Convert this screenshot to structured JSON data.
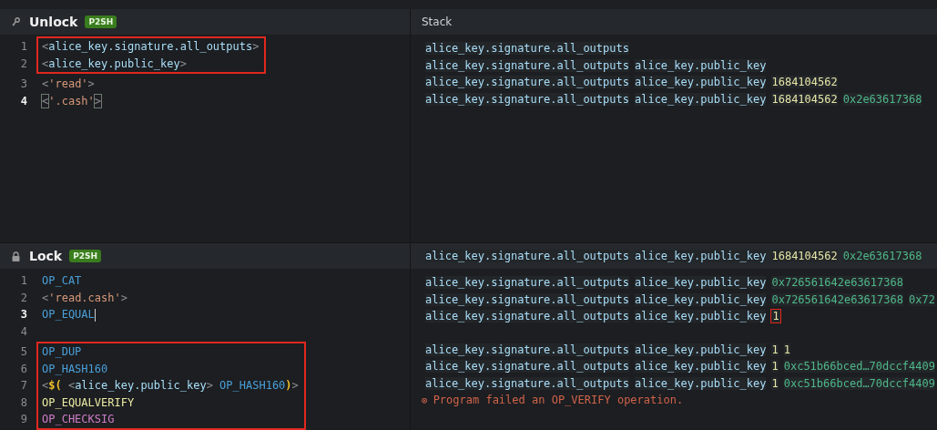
{
  "unlock": {
    "title": "Unlock",
    "badge": "P2SH",
    "groups": [
      {
        "highlighted": true,
        "lines": [
          {
            "number": "1",
            "active": false,
            "tokens": [
              {
                "kind": "punct",
                "text": "<"
              },
              {
                "kind": "name",
                "text": "alice_key.signature.all_outputs"
              },
              {
                "kind": "punct",
                "text": ">"
              }
            ]
          },
          {
            "number": "2",
            "active": false,
            "tokens": [
              {
                "kind": "punct",
                "text": "<"
              },
              {
                "kind": "name",
                "text": "alice_key.public_key"
              },
              {
                "kind": "punct",
                "text": ">"
              }
            ]
          }
        ]
      },
      {
        "highlighted": false,
        "lines": [
          {
            "number": "3",
            "active": false,
            "tokens": [
              {
                "kind": "punct",
                "text": "<"
              },
              {
                "kind": "string",
                "text": "'read'"
              },
              {
                "kind": "punct",
                "text": ">"
              }
            ]
          },
          {
            "number": "4",
            "active": true,
            "tokens": [
              {
                "kind": "match",
                "text": "<"
              },
              {
                "kind": "string",
                "text": "'.cash'"
              },
              {
                "kind": "match",
                "text": ">"
              }
            ]
          }
        ]
      }
    ]
  },
  "lock": {
    "title": "Lock",
    "badge": "P2SH",
    "groups": [
      {
        "highlighted": false,
        "lines": [
          {
            "number": "1",
            "active": false,
            "tokens": [
              {
                "kind": "opcode",
                "text": "OP_CAT"
              }
            ]
          },
          {
            "number": "2",
            "active": false,
            "tokens": [
              {
                "kind": "punct",
                "text": "<"
              },
              {
                "kind": "string",
                "text": "'read.cash'"
              },
              {
                "kind": "punct",
                "text": ">"
              }
            ]
          },
          {
            "number": "3",
            "active": true,
            "tokens": [
              {
                "kind": "opcode",
                "text": "OP_EQUAL"
              }
            ]
          },
          {
            "number": "4",
            "active": false
          }
        ]
      },
      {
        "highlighted": true,
        "lines": [
          {
            "number": "5",
            "active": false,
            "tokens": [
              {
                "kind": "opcode",
                "text": "OP_DUP"
              }
            ]
          },
          {
            "number": "6",
            "active": false,
            "tokens": [
              {
                "kind": "opcode",
                "text": "OP_HASH160"
              }
            ]
          },
          {
            "number": "7",
            "active": false,
            "tokens": [
              {
                "kind": "punct",
                "text": "<"
              },
              {
                "kind": "eval",
                "text": "$("
              },
              {
                "kind": "punct",
                "text": " <"
              },
              {
                "kind": "name",
                "text": "alice_key.public_key"
              },
              {
                "kind": "punct",
                "text": ">"
              },
              {
                "kind": "opcode",
                "text": " OP_HASH160"
              },
              {
                "kind": "eval",
                "text": ")"
              },
              {
                "kind": "punct",
                "text": ">"
              }
            ]
          },
          {
            "number": "8",
            "active": false,
            "tokens": [
              {
                "kind": "verify",
                "text": "OP_EQUALVERIFY"
              }
            ]
          },
          {
            "number": "9",
            "active": false,
            "tokens": [
              {
                "kind": "checksig",
                "text": "OP_CHECKSIG"
              }
            ]
          }
        ]
      }
    ]
  },
  "stack": {
    "title": "Stack",
    "unlock_rows": [
      {
        "items": [
          {
            "kind": "name",
            "text": "alice_key.signature.all_outputs"
          }
        ]
      },
      {
        "items": [
          {
            "kind": "name",
            "text": "alice_key.signature.all_outputs"
          },
          {
            "kind": "name",
            "text": "alice_key.public_key"
          }
        ]
      },
      {
        "items": [
          {
            "kind": "name",
            "text": "alice_key.signature.all_outputs"
          },
          {
            "kind": "name",
            "text": "alice_key.public_key"
          },
          {
            "kind": "number",
            "text": "1684104562"
          }
        ]
      },
      {
        "items": [
          {
            "kind": "name",
            "text": "alice_key.signature.all_outputs"
          },
          {
            "kind": "name",
            "text": "alice_key.public_key"
          },
          {
            "kind": "number",
            "text": "1684104562"
          },
          {
            "kind": "hex",
            "text": "0x2e63617368"
          }
        ]
      }
    ],
    "lock_header_row": {
      "items": [
        {
          "kind": "name",
          "text": "alice_key.signature.all_outputs"
        },
        {
          "kind": "name",
          "text": "alice_key.public_key"
        },
        {
          "kind": "number",
          "text": "1684104562"
        },
        {
          "kind": "hex",
          "text": "0x2e63617368"
        }
      ]
    },
    "lock_groups": [
      {
        "rows": [
          {
            "items": [
              {
                "kind": "name",
                "text": "alice_key.signature.all_outputs",
                "highlighted": false
              },
              {
                "kind": "name",
                "text": "alice_key.public_key",
                "highlighted": false
              },
              {
                "kind": "hex",
                "text": "0x726561642e63617368",
                "highlighted": false
              }
            ]
          },
          {
            "items": [
              {
                "kind": "name",
                "text": "alice_key.signature.all_outputs",
                "highlighted": false
              },
              {
                "kind": "name",
                "text": "alice_key.public_key",
                "highlighted": false
              },
              {
                "kind": "hex",
                "text": "0x726561642e63617368",
                "highlighted": false
              },
              {
                "kind": "hex",
                "text": "0x72",
                "highlighted": false
              }
            ]
          },
          {
            "items": [
              {
                "kind": "name",
                "text": "alice_key.signature.all_outputs",
                "highlighted": false
              },
              {
                "kind": "name",
                "text": "alice_key.public_key",
                "highlighted": false
              },
              {
                "kind": "number",
                "text": "1",
                "highlighted": true
              }
            ]
          }
        ]
      },
      {
        "rows": [
          {
            "items": [
              {
                "kind": "name",
                "text": "alice_key.signature.all_outputs",
                "highlighted": false
              },
              {
                "kind": "name",
                "text": "alice_key.public_key",
                "highlighted": false
              },
              {
                "kind": "number",
                "text": "1",
                "highlighted": false
              },
              {
                "kind": "number",
                "text": "1",
                "highlighted": false
              }
            ]
          },
          {
            "items": [
              {
                "kind": "name",
                "text": "alice_key.signature.all_outputs",
                "highlighted": false
              },
              {
                "kind": "name",
                "text": "alice_key.public_key",
                "highlighted": false
              },
              {
                "kind": "number",
                "text": "1",
                "highlighted": false
              },
              {
                "kind": "hex",
                "text": "0xc51b66bced…70dccf4409",
                "highlighted": false
              }
            ]
          },
          {
            "items": [
              {
                "kind": "name",
                "text": "alice_key.signature.all_outputs",
                "highlighted": false
              },
              {
                "kind": "name",
                "text": "alice_key.public_key",
                "highlighted": false
              },
              {
                "kind": "number",
                "text": "1",
                "highlighted": false
              },
              {
                "kind": "hex",
                "text": "0xc51b66bced…70dccf4409",
                "highlighted": false
              }
            ]
          }
        ]
      }
    ],
    "error": {
      "icon": "⊗",
      "text": "Program failed an OP_VERIFY operation."
    }
  }
}
